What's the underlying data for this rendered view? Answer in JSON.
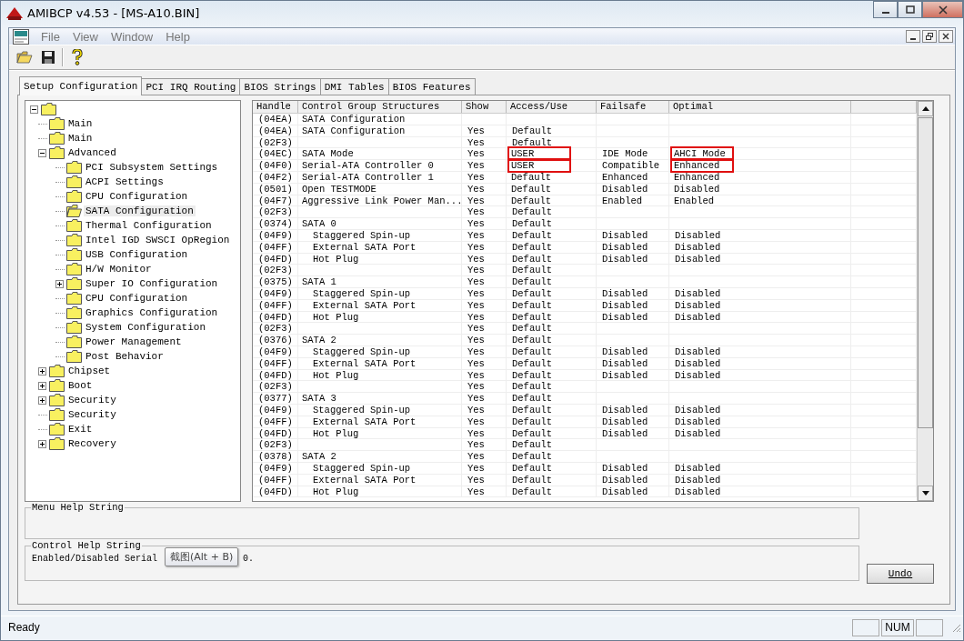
{
  "window": {
    "title": "AMIBCP v4.53 - [MS-A10.BIN]"
  },
  "menu": [
    "File",
    "View",
    "Window",
    "Help"
  ],
  "tabs": [
    {
      "label": "Setup Configuration",
      "selected": true
    },
    {
      "label": "PCI IRQ Routing",
      "selected": false
    },
    {
      "label": "BIOS Strings",
      "selected": false
    },
    {
      "label": "DMI Tables",
      "selected": false
    },
    {
      "label": "BIOS Features",
      "selected": false
    }
  ],
  "tree": {
    "expanded": true,
    "children": [
      {
        "label": "Main",
        "selected": false
      },
      {
        "label": "Main",
        "selected": false
      },
      {
        "label": "Advanced",
        "expanded": true,
        "selected": false,
        "children": [
          {
            "label": "PCI Subsystem Settings",
            "selected": false
          },
          {
            "label": "ACPI Settings",
            "selected": false
          },
          {
            "label": "CPU Configuration",
            "selected": false
          },
          {
            "label": "SATA Configuration",
            "selected": true
          },
          {
            "label": "Thermal Configuration",
            "selected": false
          },
          {
            "label": "Intel IGD SWSCI OpRegion",
            "selected": false
          },
          {
            "label": "USB Configuration",
            "selected": false
          },
          {
            "label": "H/W Monitor",
            "selected": false
          },
          {
            "label": "Super IO Configuration",
            "expanded": false,
            "selected": false
          },
          {
            "label": "CPU Configuration",
            "selected": false
          },
          {
            "label": "Graphics Configuration",
            "selected": false
          },
          {
            "label": "System Configuration",
            "selected": false
          },
          {
            "label": "Power Management",
            "selected": false
          },
          {
            "label": "Post Behavior",
            "selected": false
          }
        ]
      },
      {
        "label": "Chipset",
        "expanded": false,
        "selected": false
      },
      {
        "label": "Boot",
        "expanded": false,
        "selected": false
      },
      {
        "label": "Security",
        "expanded": false,
        "selected": false
      },
      {
        "label": "Security",
        "selected": false
      },
      {
        "label": "Exit",
        "selected": false
      },
      {
        "label": "Recovery",
        "expanded": false,
        "selected": false
      }
    ]
  },
  "table": {
    "columns": [
      "Handle",
      "Control Group Structures",
      "Show",
      "Access/Use",
      "Failsafe",
      "Optimal"
    ],
    "rows": [
      {
        "handle": "(04EA)",
        "name": "SATA Configuration"
      },
      {
        "handle": "(04EA)",
        "name": "SATA Configuration",
        "show": "Yes",
        "access": "Default"
      },
      {
        "handle": "(02F3)",
        "show": "Yes",
        "access": "Default"
      },
      {
        "handle": "(04EC)",
        "name": "SATA Mode",
        "show": "Yes",
        "access": "USER",
        "failsafe": "IDE Mode",
        "optimal": "AHCI Mode",
        "marked": true
      },
      {
        "handle": "(04F0)",
        "name": "Serial-ATA Controller 0",
        "show": "Yes",
        "access": "USER",
        "failsafe": "Compatible",
        "optimal": "Enhanced",
        "marked": true
      },
      {
        "handle": "(04F2)",
        "name": "Serial-ATA Controller 1",
        "show": "Yes",
        "access": "Default",
        "failsafe": "Enhanced",
        "optimal": "Enhanced",
        "marked": false
      },
      {
        "handle": "(0501)",
        "name": "Open TESTMODE",
        "show": "Yes",
        "access": "Default",
        "failsafe": "Disabled",
        "optimal": "Disabled",
        "marked": false
      },
      {
        "handle": "(04F7)",
        "name": "Aggressive Link Power Man...",
        "show": "Yes",
        "access": "Default",
        "failsafe": "Enabled",
        "optimal": "Enabled",
        "marked": false
      },
      {
        "handle": "(02F3)",
        "show": "Yes",
        "access": "Default"
      },
      {
        "handle": "(0374)",
        "name": "SATA 0",
        "show": "Yes",
        "access": "Default",
        "children": [
          {
            "handle": "(04F9)",
            "name": "Staggered Spin-up",
            "show": "Yes",
            "access": "Default",
            "failsafe": "Disabled",
            "optimal": "Disabled"
          },
          {
            "handle": "(04FF)",
            "name": "External SATA Port",
            "show": "Yes",
            "access": "Default",
            "failsafe": "Disabled",
            "optimal": "Disabled"
          },
          {
            "handle": "(04FD)",
            "name": "Hot Plug",
            "show": "Yes",
            "access": "Default",
            "failsafe": "Disabled",
            "optimal": "Disabled"
          }
        ]
      },
      {
        "handle": "(02F3)",
        "show": "Yes",
        "access": "Default"
      },
      {
        "handle": "(0375)",
        "name": "SATA 1",
        "show": "Yes",
        "access": "Default",
        "children": [
          {
            "handle": "(04F9)",
            "name": "Staggered Spin-up",
            "show": "Yes",
            "access": "Default",
            "failsafe": "Disabled",
            "optimal": "Disabled"
          },
          {
            "handle": "(04FF)",
            "name": "External SATA Port",
            "show": "Yes",
            "access": "Default",
            "failsafe": "Disabled",
            "optimal": "Disabled"
          },
          {
            "handle": "(04FD)",
            "name": "Hot Plug",
            "show": "Yes",
            "access": "Default",
            "failsafe": "Disabled",
            "optimal": "Disabled"
          }
        ]
      },
      {
        "handle": "(02F3)",
        "show": "Yes",
        "access": "Default"
      },
      {
        "handle": "(0376)",
        "name": "SATA 2",
        "show": "Yes",
        "access": "Default",
        "children": [
          {
            "handle": "(04F9)",
            "name": "Staggered Spin-up",
            "show": "Yes",
            "access": "Default",
            "failsafe": "Disabled",
            "optimal": "Disabled"
          },
          {
            "handle": "(04FF)",
            "name": "External SATA Port",
            "show": "Yes",
            "access": "Default",
            "failsafe": "Disabled",
            "optimal": "Disabled"
          },
          {
            "handle": "(04FD)",
            "name": "Hot Plug",
            "show": "Yes",
            "access": "Default",
            "failsafe": "Disabled",
            "optimal": "Disabled"
          }
        ]
      },
      {
        "handle": "(02F3)",
        "show": "Yes",
        "access": "Default"
      },
      {
        "handle": "(0377)",
        "name": "SATA 3",
        "show": "Yes",
        "access": "Default",
        "children": [
          {
            "handle": "(04F9)",
            "name": "Staggered Spin-up",
            "show": "Yes",
            "access": "Default",
            "failsafe": "Disabled",
            "optimal": "Disabled"
          },
          {
            "handle": "(04FF)",
            "name": "External SATA Port",
            "show": "Yes",
            "access": "Default",
            "failsafe": "Disabled",
            "optimal": "Disabled"
          },
          {
            "handle": "(04FD)",
            "name": "Hot Plug",
            "show": "Yes",
            "access": "Default",
            "failsafe": "Disabled",
            "optimal": "Disabled"
          }
        ]
      },
      {
        "handle": "(02F3)",
        "show": "Yes",
        "access": "Default"
      },
      {
        "handle": "(0378)",
        "name": "SATA 2",
        "show": "Yes",
        "access": "Default",
        "children": [
          {
            "handle": "(04F9)",
            "name": "Staggered Spin-up",
            "show": "Yes",
            "access": "Default",
            "failsafe": "Disabled",
            "optimal": "Disabled"
          },
          {
            "handle": "(04FF)",
            "name": "External SATA Port",
            "show": "Yes",
            "access": "Default",
            "failsafe": "Disabled",
            "optimal": "Disabled"
          },
          {
            "handle": "(04FD)",
            "name": "Hot Plug",
            "show": "Yes",
            "access": "Default",
            "failsafe": "Disabled",
            "optimal": "Disabled"
          }
        ]
      }
    ]
  },
  "menu_help": {
    "title": "Menu Help String"
  },
  "control_help": {
    "title": "Control Help String",
    "text_before": "Enabled/Disabled Serial",
    "text_after": "0."
  },
  "tooltip": "截图(Alt + B)",
  "undo_button": "Undo",
  "status_bar": {
    "text": "Ready",
    "num_lock": "NUM"
  }
}
